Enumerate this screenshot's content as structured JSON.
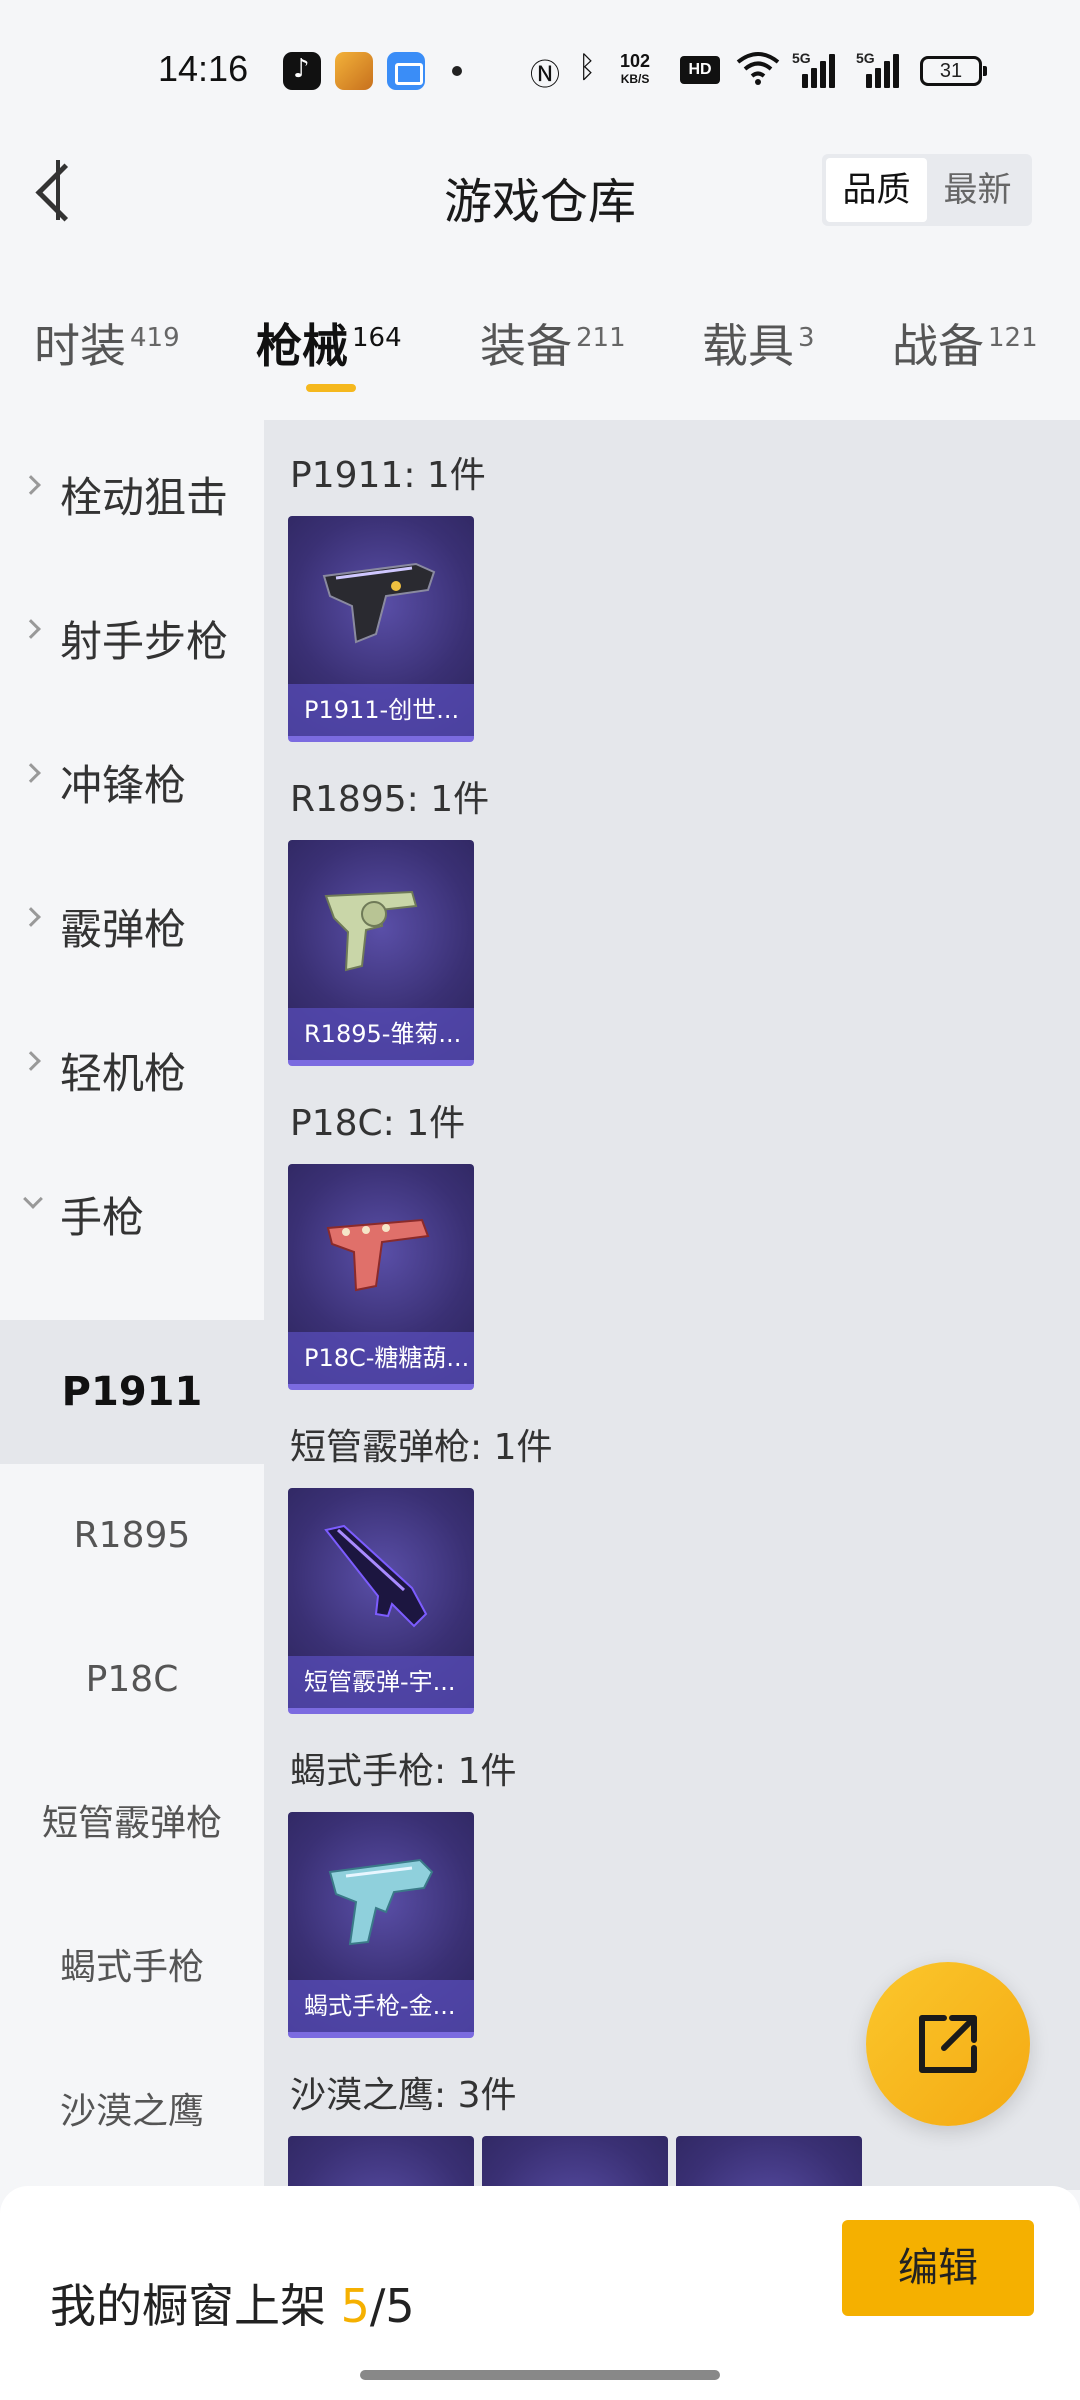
{
  "status_bar": {
    "time": "14:16",
    "network_speed_top": "102",
    "network_speed_unit": "KB/S",
    "hd": "HD",
    "net_1": "5G",
    "net_2": "5G",
    "battery": "31"
  },
  "header": {
    "title": "游戏仓库",
    "sort_options": [
      "品质",
      "最新"
    ],
    "sort_selected": "品质"
  },
  "tabs": [
    {
      "label": "时装",
      "count": "419"
    },
    {
      "label": "枪械",
      "count": "164",
      "active": true
    },
    {
      "label": "装备",
      "count": "211"
    },
    {
      "label": "载具",
      "count": "3"
    },
    {
      "label": "战备",
      "count": "121"
    }
  ],
  "sidebar": {
    "groups": [
      {
        "label": "栓动狙击"
      },
      {
        "label": "射手步枪"
      },
      {
        "label": "冲锋枪"
      },
      {
        "label": "霰弹枪"
      },
      {
        "label": "轻机枪"
      },
      {
        "label": "手枪",
        "expanded": true
      }
    ],
    "subitems": [
      {
        "label": "P1911",
        "active": true
      },
      {
        "label": "R1895"
      },
      {
        "label": "P18C"
      },
      {
        "label": "短管霰弹枪"
      },
      {
        "label": "蝎式手枪"
      },
      {
        "label": "沙漠之鹰"
      }
    ]
  },
  "sections": [
    {
      "title": "P1911: 1件",
      "items": [
        {
          "label": "P1911-创世...",
          "icon": "pistol-dark-icon"
        }
      ]
    },
    {
      "title": "R1895: 1件",
      "items": [
        {
          "label": "R1895-雏菊...",
          "icon": "revolver-icon"
        }
      ]
    },
    {
      "title": "P18C: 1件",
      "items": [
        {
          "label": "P18C-糖糖葫...",
          "icon": "pistol-red-icon"
        }
      ]
    },
    {
      "title": "短管霰弹枪: 1件",
      "items": [
        {
          "label": "短管霰弹-宇...",
          "icon": "shotgun-icon"
        }
      ]
    },
    {
      "title": "蝎式手枪: 1件",
      "items": [
        {
          "label": "蝎式手枪-金...",
          "icon": "smg-icon"
        }
      ]
    },
    {
      "title": "沙漠之鹰: 3件",
      "items": []
    }
  ],
  "bottom_bar": {
    "showcase_prefix": "我的橱窗上架 ",
    "showcase_current": "5",
    "showcase_sep": "/5",
    "edit_label": "编辑"
  },
  "colors": {
    "accent": "#f5b000",
    "card_bg": "#3a3074",
    "tab_underline": "#f5b81e"
  }
}
